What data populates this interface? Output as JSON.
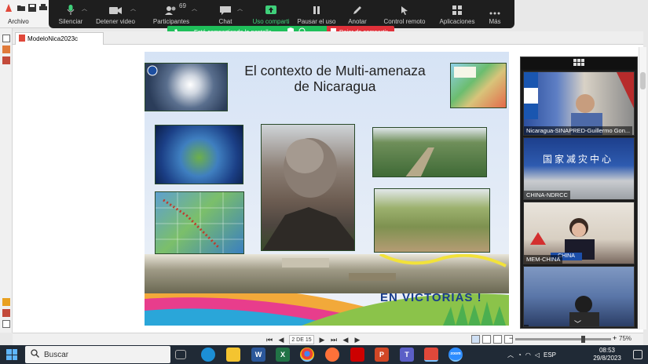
{
  "app": {
    "file_label": "Archivo"
  },
  "zoom_toolbar": {
    "participants_count": "69",
    "items": [
      {
        "label": "Silenciar",
        "icon": "microphone-icon"
      },
      {
        "label": "Detener video",
        "icon": "video-camera-icon"
      },
      {
        "label": "Participantes",
        "icon": "participants-icon"
      },
      {
        "label": "Chat",
        "icon": "chat-icon"
      },
      {
        "label": "Uso comparti",
        "icon": "share-screen-icon"
      },
      {
        "label": "Pausar el uso",
        "icon": "pause-icon"
      },
      {
        "label": "Anotar",
        "icon": "pen-icon"
      },
      {
        "label": "Control remoto",
        "icon": "remote-control-icon"
      },
      {
        "label": "Aplicaciones",
        "icon": "apps-icon"
      },
      {
        "label": "Más",
        "icon": "more-dots-icon"
      }
    ]
  },
  "share_banner": {
    "status": "Está compartiendo la pantalla",
    "stop": "Dejar de compartir",
    "colors": {
      "status": "#1fbf5a",
      "stop": "#e0313a"
    }
  },
  "document": {
    "tab_title": "ModeloNica2023c"
  },
  "slide": {
    "title_line1": "El contexto de Multi-amenaza",
    "title_line2": "de Nicaragua",
    "slogan": "EN VICTORIAS !"
  },
  "video_panel": {
    "tiles": [
      {
        "name": "Nicaragua-SINAPRED-Guillermo Gon..."
      },
      {
        "name": "CHINA-NDRCC",
        "banner": "国家减灾中心"
      },
      {
        "name": "MEM-CHINA",
        "nameplate": "CHINA"
      },
      {
        "name": ""
      }
    ]
  },
  "statusbar": {
    "page": "2 DE 15",
    "zoom": "75%"
  },
  "taskbar": {
    "search_placeholder": "Buscar",
    "language": "ESP",
    "time": "08:53",
    "date": "29/8/2023"
  }
}
